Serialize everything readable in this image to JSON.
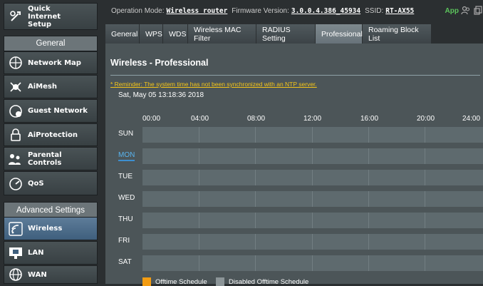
{
  "sidebar": {
    "top_button": {
      "label": "Quick Internet Setup",
      "icon": "quick-setup-icon"
    },
    "general_header": "General",
    "general_items": [
      {
        "label": "Network Map",
        "icon": "network-map-icon"
      },
      {
        "label": "AiMesh",
        "icon": "aimesh-icon"
      },
      {
        "label": "Guest Network",
        "icon": "guest-network-icon"
      },
      {
        "label": "AiProtection",
        "icon": "aiprotection-lock-icon"
      },
      {
        "label": "Parental Controls",
        "icon": "parental-controls-icon"
      },
      {
        "label": "QoS",
        "icon": "qos-gauge-icon"
      }
    ],
    "advanced_header": "Advanced Settings",
    "advanced_items": [
      {
        "label": "Wireless",
        "icon": "wireless-icon",
        "active": true
      },
      {
        "label": "LAN",
        "icon": "lan-icon"
      },
      {
        "label": "WAN",
        "icon": "wan-globe-icon"
      }
    ]
  },
  "topbar": {
    "mode_label": "Operation Mode:",
    "mode_value": "Wireless router",
    "fw_label": "Firmware Version:",
    "fw_value": "3.0.0.4.386_45934",
    "ssid_label": "SSID:",
    "ssid_value": "RT-AX55",
    "app_label": "App"
  },
  "tabs": [
    {
      "label": "General"
    },
    {
      "label": "WPS"
    },
    {
      "label": "WDS"
    },
    {
      "label": "Wireless MAC Filter"
    },
    {
      "label": "RADIUS Setting"
    },
    {
      "label": "Professional",
      "active": true
    },
    {
      "label": "Roaming Block List"
    }
  ],
  "main": {
    "title": "Wireless - Professional",
    "reminder": "* Reminder: The system time has not been synchronized with an NTP server.",
    "system_time": "Sat, May 05 13:18:36 2018"
  },
  "schedule": {
    "hours": [
      "00:00",
      "04:00",
      "08:00",
      "12:00",
      "16:00",
      "20:00",
      "24:00"
    ],
    "days": [
      "SUN",
      "MON",
      "TUE",
      "WED",
      "THU",
      "FRI",
      "SAT"
    ],
    "selected_day": "MON",
    "legend": [
      {
        "label": "Offtime Schedule",
        "color": "#f39c12"
      },
      {
        "label": "Disabled Offtime Schedule",
        "color": "#8c9598"
      }
    ]
  }
}
